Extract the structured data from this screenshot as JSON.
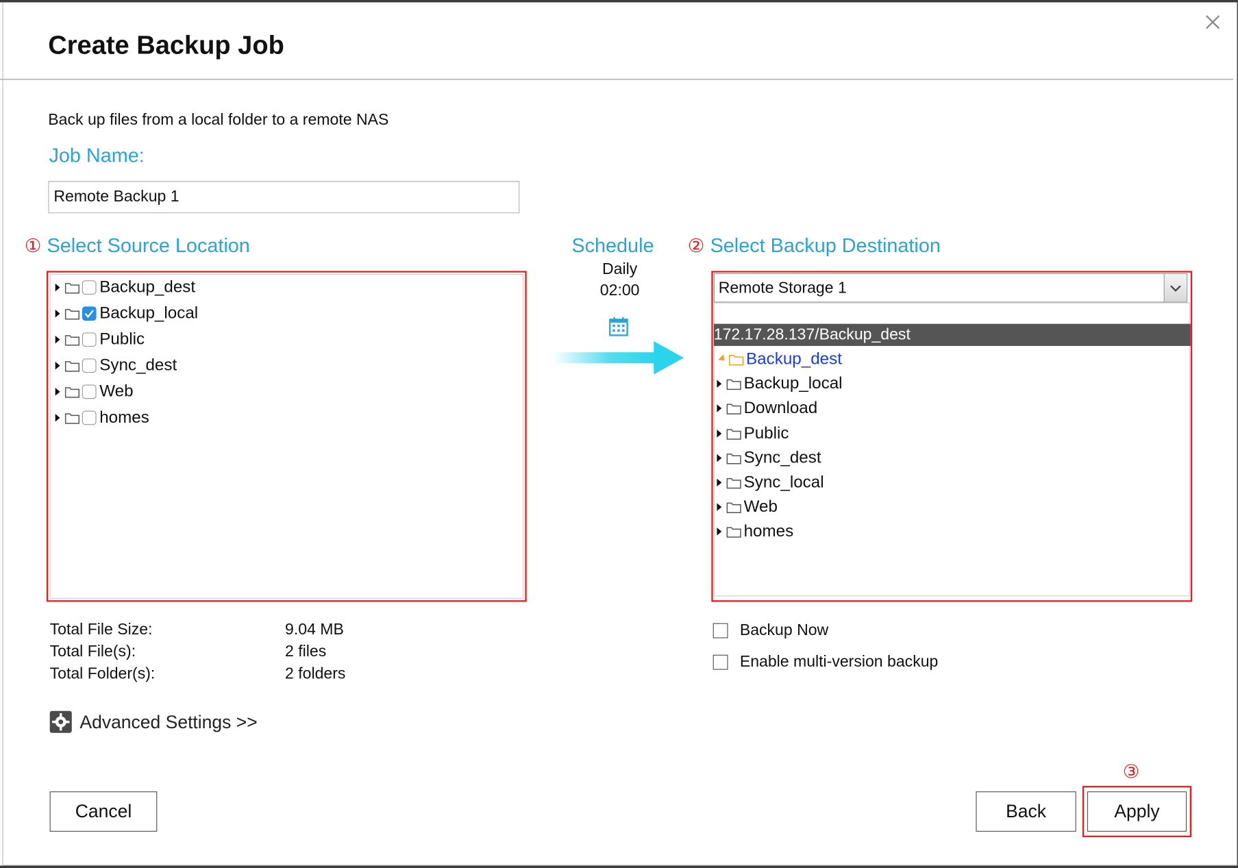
{
  "dialog": {
    "title": "Create Backup Job",
    "description": "Back up files from a local folder to a remote NAS"
  },
  "job": {
    "label": "Job Name:",
    "value": "Remote Backup 1"
  },
  "source": {
    "marker": "①",
    "label": "Select Source Location",
    "items": [
      {
        "name": "Backup_dest",
        "checked": false
      },
      {
        "name": "Backup_local",
        "checked": true
      },
      {
        "name": "Public",
        "checked": false
      },
      {
        "name": "Sync_dest",
        "checked": false
      },
      {
        "name": "Web",
        "checked": false
      },
      {
        "name": "homes",
        "checked": false
      }
    ]
  },
  "schedule": {
    "label": "Schedule",
    "frequency": "Daily",
    "time": "02:00"
  },
  "destination": {
    "marker": "②",
    "label": "Select Backup Destination",
    "storage": "Remote Storage 1",
    "path": "172.17.28.137/Backup_dest",
    "items": [
      {
        "name": "Backup_dest",
        "selected": true
      },
      {
        "name": "Backup_local",
        "selected": false
      },
      {
        "name": "Download",
        "selected": false
      },
      {
        "name": "Public",
        "selected": false
      },
      {
        "name": "Sync_dest",
        "selected": false
      },
      {
        "name": "Sync_local",
        "selected": false
      },
      {
        "name": "Web",
        "selected": false
      },
      {
        "name": "homes",
        "selected": false
      }
    ]
  },
  "stats": {
    "size_label": "Total File Size:",
    "size_value": "9.04 MB",
    "files_label": "Total File(s):",
    "files_value": "2 files",
    "folders_label": "Total Folder(s):",
    "folders_value": "2 folders"
  },
  "advanced": {
    "label": "Advanced Settings >>"
  },
  "options": {
    "backup_now": "Backup Now",
    "multi_version": "Enable multi-version backup"
  },
  "buttons": {
    "cancel": "Cancel",
    "back": "Back",
    "apply": "Apply",
    "apply_marker": "③"
  },
  "colors": {
    "accent": "#2aa3d8",
    "highlight": "#e02020",
    "checked": "#2a8fe0",
    "selected_text": "#1a3de0",
    "folder_open": "#f0a020",
    "path_bar": "#555555"
  }
}
